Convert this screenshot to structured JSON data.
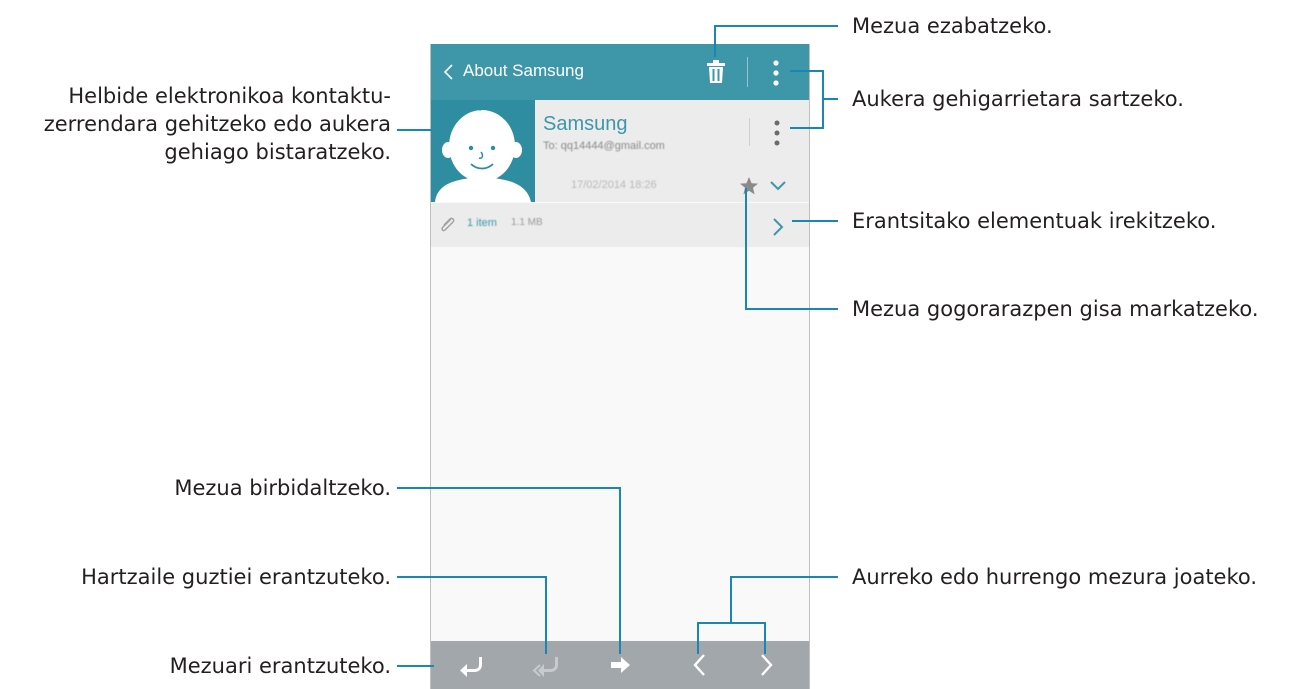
{
  "app": {
    "back_label": "About Samsung",
    "sender_name": "Samsung",
    "recipient_line": "To: qq14444@gmail.com",
    "date_time": "17/02/2014 18:26",
    "attachment_count": "1 item",
    "attachment_size": "1.1 MB"
  },
  "icons": {
    "back": "chevron-left-icon",
    "delete": "trash-icon",
    "more": "more-vertical-icon",
    "star": "star-icon",
    "expand": "chevron-down-icon",
    "attachment": "paperclip-icon",
    "open_attachments": "chevron-right-icon",
    "reply": "reply-icon",
    "reply_all": "reply-all-icon",
    "forward": "forward-icon",
    "previous": "chevron-left-icon",
    "next": "chevron-right-icon"
  },
  "colors": {
    "action_bar": "#3e96a9",
    "accent": "#3e96a9",
    "bottom_bar": "#a1a7ab",
    "callout_line": "#1b86b1",
    "text": "#231f20"
  },
  "callouts": {
    "delete": "Mezua ezabatzeko.",
    "more_options": "Aukera gehigarrietara sartzeko.",
    "contact_line1": "Helbide elektronikoa kontaktu-",
    "contact_line2": "zerrendara gehitzeko edo aukera",
    "contact_line3": "gehiago bistaratzeko.",
    "open_attachments": "Erantsitako elementuak irekitzeko.",
    "mark_reminder": "Mezua gogorarazpen gisa markatzeko.",
    "forward": "Mezua birbidaltzeko.",
    "reply_all": "Hartzaile guztiei erantzuteko.",
    "prev_next": "Aurreko edo hurrengo mezura joateko.",
    "reply": "Mezuari erantzuteko."
  }
}
